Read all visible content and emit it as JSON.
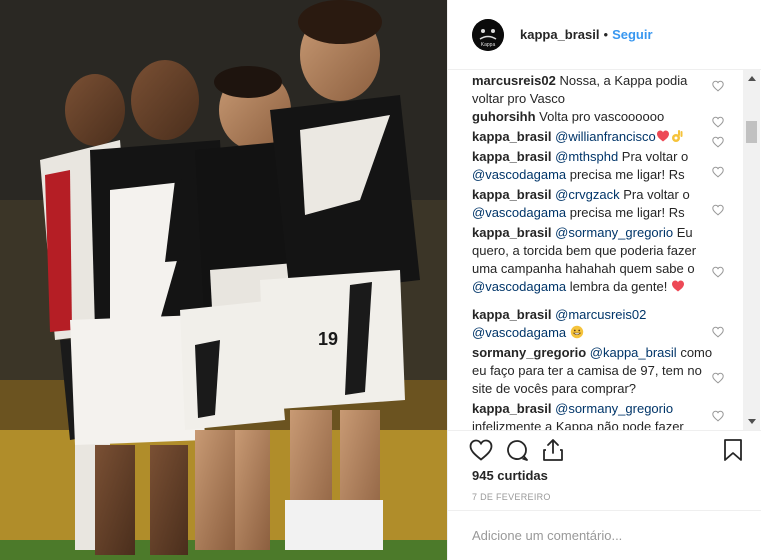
{
  "post": {
    "account": "kappa_brasil",
    "separator": "•",
    "follow_label": "Seguir",
    "avatar_text": "Kappa",
    "likes_text": "945 curtidas",
    "date_text": "7 DE FEVEREIRO",
    "add_comment_placeholder": "Adicione um comentário...",
    "photo_description": "Vasco da Gama players celebrating",
    "jersey_number": "19"
  },
  "colors": {
    "link": "#3897f0",
    "mention": "#003569",
    "heart": "#ed4956",
    "emoji": "#f5c33b"
  },
  "comments": [
    {
      "user": "marcusreis02",
      "parts": [
        {
          "t": "Nossa, a Kappa podia voltar pro Vasco"
        }
      ]
    },
    {
      "user": "guhorsihh",
      "parts": [
        {
          "t": "Volta pro vascoooooo"
        }
      ]
    },
    {
      "user": "kappa_brasil",
      "parts": [
        {
          "t": "@willianfrancisco",
          "m": true
        }
      ],
      "emoji": [
        "red-heart-emoji",
        "ok-hand-emoji"
      ]
    },
    {
      "user": "kappa_brasil",
      "parts": [
        {
          "t": "@mthsphd",
          "m": true
        },
        {
          "t": " Pra voltar o "
        },
        {
          "t": "@vascodagama",
          "m": true
        },
        {
          "t": " precisa me ligar! Rs"
        }
      ]
    },
    {
      "user": "kappa_brasil",
      "parts": [
        {
          "t": "@crvgzack",
          "m": true
        },
        {
          "t": " Pra voltar o "
        },
        {
          "t": "@vascodagama",
          "m": true
        },
        {
          "t": " precisa me ligar! Rs"
        }
      ]
    },
    {
      "user": "kappa_brasil",
      "parts": [
        {
          "t": "@sormany_gregorio",
          "m": true
        },
        {
          "t": " Eu quero, a torcida bem que poderia fazer uma campanha hahahah quem sabe o "
        },
        {
          "t": "@vascodagama",
          "m": true
        },
        {
          "t": " lembra da gente! "
        }
      ],
      "emoji": [
        "red-heart-emoji"
      ]
    },
    {
      "user": "kappa_brasil",
      "parts": [
        {
          "t": "@marcusreis02",
          "m": true
        },
        {
          "t": " "
        },
        {
          "t": "@vascodagama",
          "m": true
        },
        {
          "t": " "
        }
      ],
      "emoji": [
        "grin-emoji"
      ]
    },
    {
      "user": "sormany_gregorio",
      "parts": [
        {
          "t": "@kappa_brasil",
          "m": true
        },
        {
          "t": " como eu faço para ter a camisa de 97, tem no site de vocês para comprar?"
        }
      ]
    },
    {
      "user": "kappa_brasil",
      "parts": [
        {
          "t": "@sormany_gregorio",
          "m": true
        },
        {
          "t": " infelizmente a Kappa não pode fazer"
        }
      ]
    }
  ],
  "icons": {
    "like": "heart-outline-icon",
    "comment": "comment-bubble-icon",
    "share": "share-upload-icon",
    "save": "bookmark-icon",
    "comment_like": "small-heart-icon"
  }
}
